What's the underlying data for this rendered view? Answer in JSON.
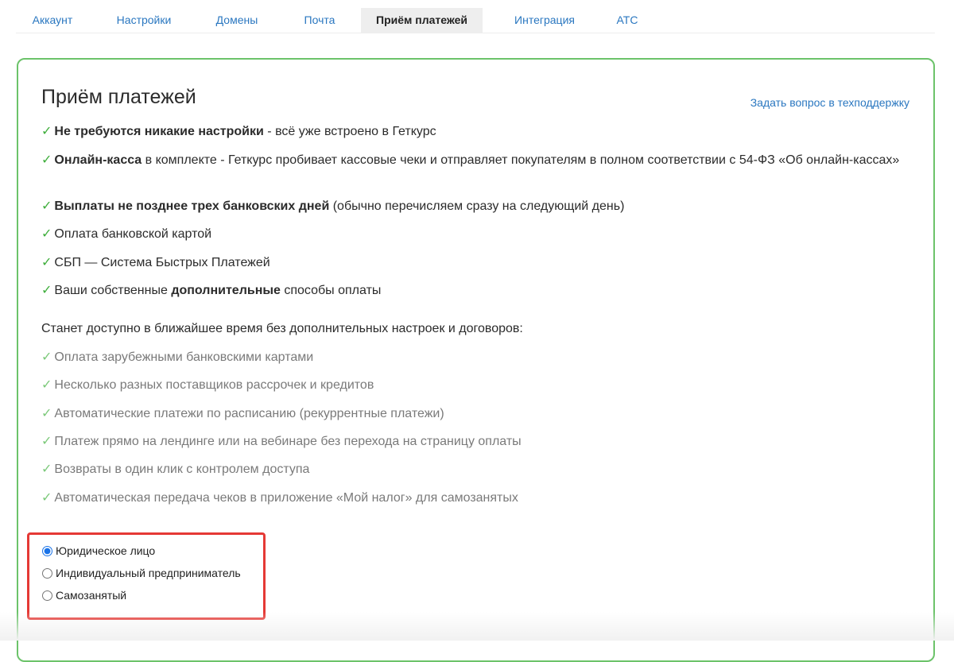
{
  "tabs": [
    {
      "label": "Аккаунт",
      "active": false
    },
    {
      "label": "Настройки",
      "active": false
    },
    {
      "label": "Домены",
      "active": false
    },
    {
      "label": "Почта",
      "active": false
    },
    {
      "label": "Приём платежей",
      "active": true
    },
    {
      "label": "Интеграция",
      "active": false
    },
    {
      "label": "АТС",
      "active": false
    }
  ],
  "page": {
    "title": "Приём платежей",
    "support_link": "Задать вопрос в техподдержку"
  },
  "check_glyph": "✓",
  "features": [
    {
      "bold": "Не требуются никакие настройки",
      "text": " - всё уже встроено в Геткурс"
    },
    {
      "bold": "Онлайн-касса",
      "text": " в комплекте - Геткурс пробивает кассовые чеки и отправляет покупателям в полном соответствии с 54-ФЗ «Об онлайн-кассах»"
    },
    {
      "bold": "Выплаты не позднее трех банковских дней",
      "text": " (обычно перечисляем сразу на следующий день)"
    },
    {
      "pre": "Оплата банковской картой"
    },
    {
      "pre": "СБП — Система Быстрых Платежей"
    },
    {
      "pre": "Ваши собственные ",
      "bold": "дополнительные",
      "text": " способы оплаты"
    }
  ],
  "soon": {
    "intro": "Станет доступно в ближайшее время без дополнительных настроек и договоров:",
    "items": [
      "Оплата зарубежными банковскими картами",
      "Несколько разных поставщиков рассрочек и кредитов",
      "Автоматические платежи по расписанию (рекуррентные платежи)",
      "Платеж прямо на лендинге или на вебинаре без перехода на страницу оплаты",
      "Возвраты в один клик с контролем доступа",
      "Автоматическая передача чеков в приложение «Мой налог» для самозанятых"
    ]
  },
  "entity_type": {
    "options": [
      {
        "label": "Юридическое лицо",
        "checked": true
      },
      {
        "label": "Индивидуальный предприниматель",
        "checked": false
      },
      {
        "label": "Самозанятый",
        "checked": false
      }
    ]
  },
  "colors": {
    "accent": "#2a77c0",
    "card_border": "#6cc36a",
    "check": "#3fae3c",
    "highlight": "#e53935"
  }
}
